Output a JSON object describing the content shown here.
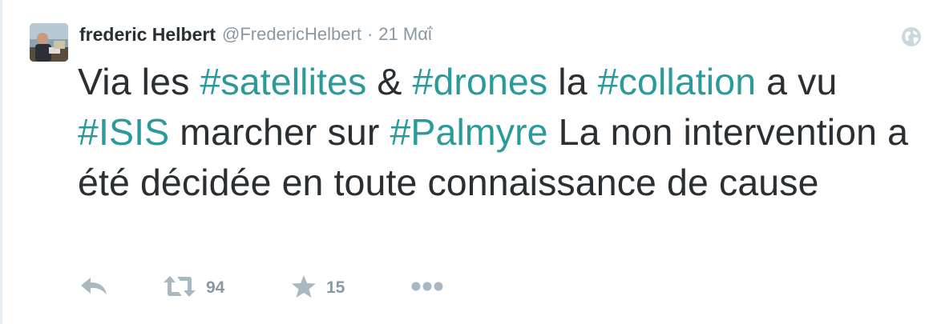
{
  "tweet": {
    "author": {
      "display_name": "frederic Helbert",
      "handle": "@FredericHelbert"
    },
    "separator": "·",
    "timestamp": "21 Μαΐ",
    "text_segments": [
      {
        "text": "Via les ",
        "hashtag": false
      },
      {
        "text": "#satellites",
        "hashtag": true
      },
      {
        "text": " & ",
        "hashtag": false
      },
      {
        "text": "#drones",
        "hashtag": true
      },
      {
        "text": " la ",
        "hashtag": false
      },
      {
        "text": "#collation",
        "hashtag": true
      },
      {
        "text": " a vu ",
        "hashtag": false
      },
      {
        "text": "#ISIS",
        "hashtag": true
      },
      {
        "text": " marcher sur ",
        "hashtag": false
      },
      {
        "text": "#Palmyre",
        "hashtag": true
      },
      {
        "text": " La non intervention a été décidée en toute connaissance de cause",
        "hashtag": false
      }
    ],
    "actions": {
      "retweet_count": "94",
      "favorite_count": "15"
    },
    "icons": {
      "globe": "globe-icon",
      "reply": "reply-icon",
      "retweet": "retweet-icon",
      "favorite": "star-icon",
      "more": "more-dots-icon"
    },
    "colors": {
      "text": "#292f33",
      "muted": "#8899a6",
      "hashtag": "#2b9a9a",
      "icon": "#aab8c2"
    }
  }
}
